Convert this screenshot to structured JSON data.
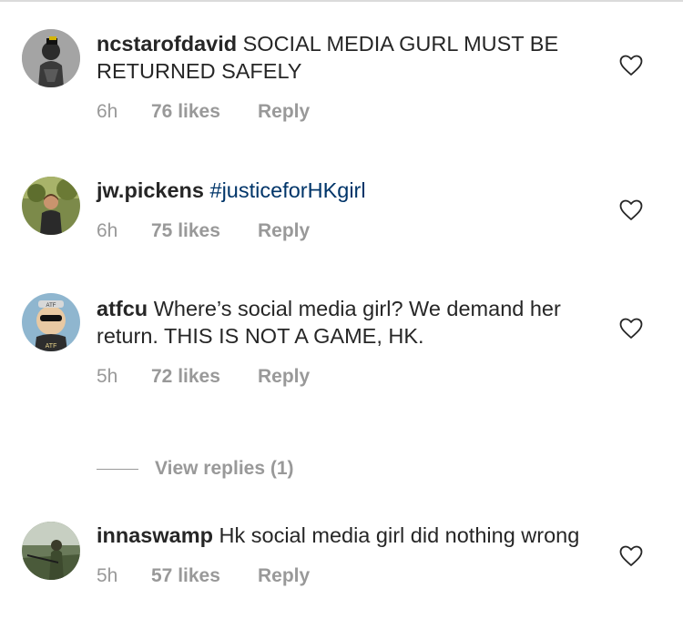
{
  "comments": [
    {
      "username": "ncstarofdavid",
      "text": "SOCIAL MEDIA GURL MUST BE RETURNED SAFELY",
      "time": "6h",
      "likes": "76 likes",
      "reply": "Reply",
      "avatar": "armored-figure-avatar"
    },
    {
      "username": "jw.pickens",
      "text": "#justiceforHKgirl",
      "time": "6h",
      "likes": "75 likes",
      "reply": "Reply",
      "avatar": "person-outdoors-avatar"
    },
    {
      "username": "atfcu",
      "text": "Where’s social media girl? We demand her return. THIS IS NOT A GAME, HK.",
      "time": "5h",
      "likes": "72 likes",
      "reply": "Reply",
      "avatar": "cartoon-sunglasses-avatar",
      "view_replies": "View replies (1)"
    },
    {
      "username": "innaswamp",
      "text": "Hk social media girl did nothing wrong",
      "time": "5h",
      "likes": "57 likes",
      "reply": "Reply",
      "avatar": "soldier-swamp-avatar"
    }
  ],
  "colors": {
    "text": "#262626",
    "meta": "#999999",
    "hashtag": "#003569",
    "divider": "#dbdbdb"
  },
  "icons": {
    "like": "heart-outline-icon"
  }
}
